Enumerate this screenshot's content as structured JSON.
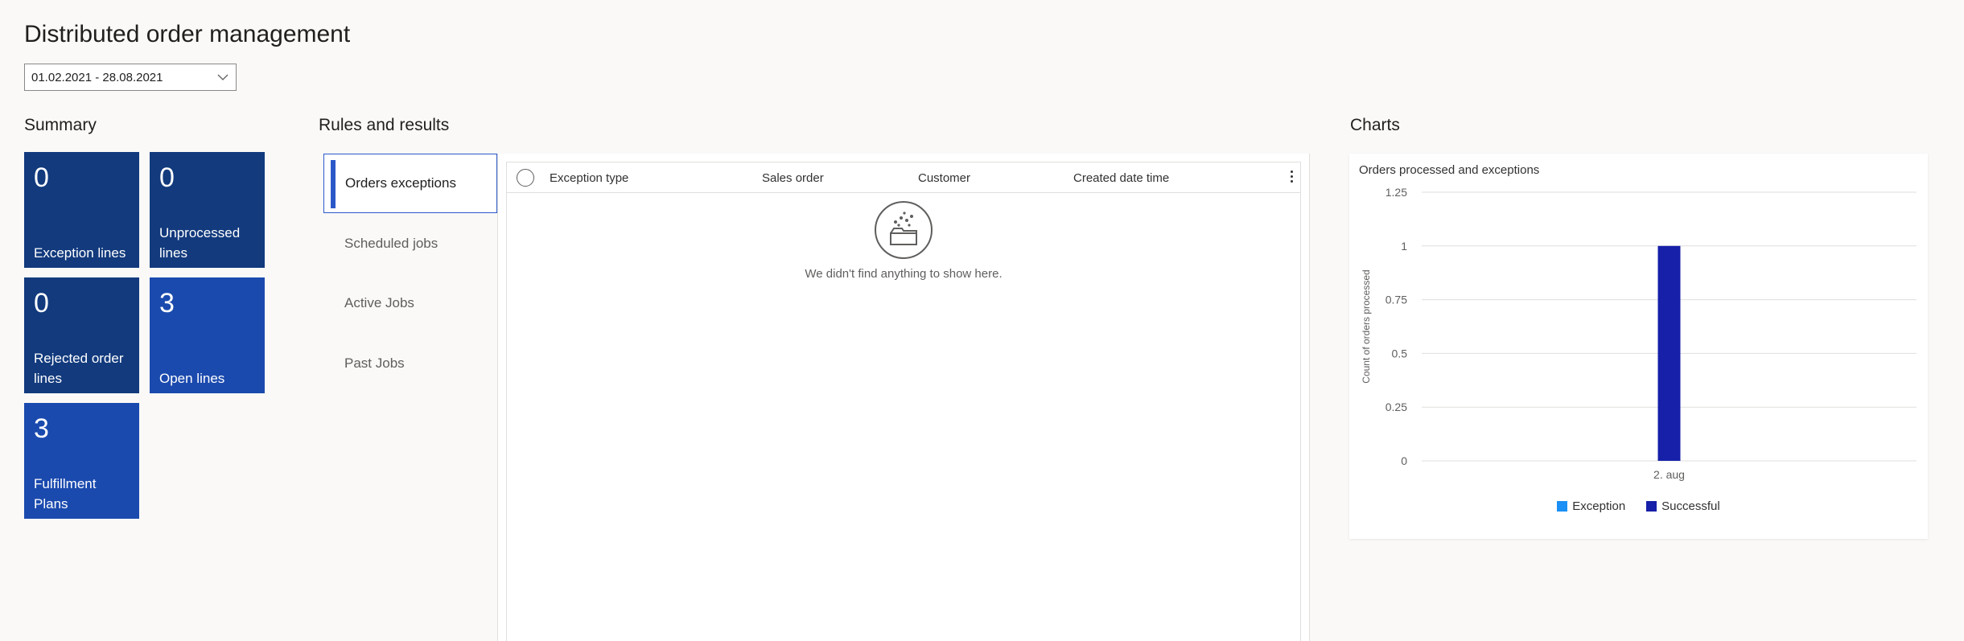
{
  "page": {
    "title": "Distributed order management",
    "date_range": "01.02.2021 - 28.08.2021"
  },
  "summary": {
    "title": "Summary",
    "tiles": [
      {
        "count": "0",
        "label": "Exception lines",
        "color": "#123a7d"
      },
      {
        "count": "0",
        "label": "Unprocessed lines",
        "color": "#123a7d"
      },
      {
        "count": "0",
        "label": "Rejected order lines",
        "color": "#123a7d"
      },
      {
        "count": "3",
        "label": "Open lines",
        "color": "#1b4aae"
      },
      {
        "count": "3",
        "label": "Fulfillment Plans",
        "color": "#1b4aae"
      }
    ]
  },
  "rules": {
    "title": "Rules and results",
    "nav": [
      {
        "label": "Orders exceptions",
        "active": true
      },
      {
        "label": "Scheduled jobs",
        "active": false
      },
      {
        "label": "Active Jobs",
        "active": false
      },
      {
        "label": "Past Jobs",
        "active": false
      }
    ],
    "grid": {
      "columns": [
        "Exception type",
        "Sales order",
        "Customer",
        "Created date time"
      ],
      "empty_message": "We didn't find anything to show here."
    }
  },
  "charts": {
    "title": "Charts"
  },
  "chart_data": {
    "type": "bar",
    "title": "Orders processed and exceptions",
    "ylabel": "Count of orders processed",
    "xlabel": "",
    "categories": [
      "2. aug"
    ],
    "series": [
      {
        "name": "Exception",
        "values": [
          0
        ],
        "color": "#1a8ff5"
      },
      {
        "name": "Successful",
        "values": [
          1
        ],
        "color": "#1620a8"
      }
    ],
    "ylim": [
      0,
      1.25
    ],
    "yticks": [
      "1.25",
      "1",
      "0.75",
      "0.5",
      "0.25",
      "0"
    ],
    "ytick_values": [
      1.25,
      1,
      0.75,
      0.5,
      0.25,
      0
    ],
    "grid": true,
    "legend_position": "bottom"
  }
}
